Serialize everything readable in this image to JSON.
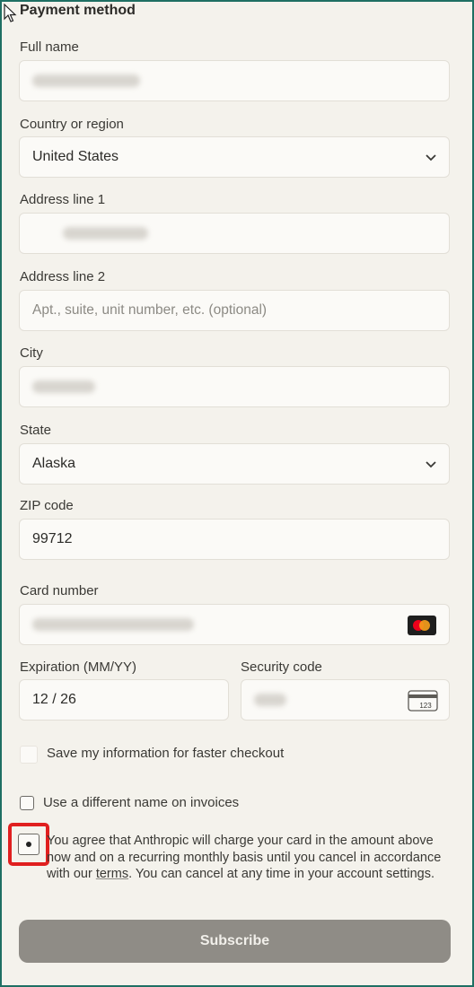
{
  "section_title": "Payment method",
  "fields": {
    "full_name_label": "Full name",
    "country_label": "Country or region",
    "country_value": "United States",
    "address1_label": "Address line 1",
    "address2_label": "Address line 2",
    "address2_placeholder": "Apt., suite, unit number, etc. (optional)",
    "city_label": "City",
    "state_label": "State",
    "state_value": "Alaska",
    "zip_label": "ZIP code",
    "zip_value": "99712",
    "card_number_label": "Card number",
    "expiration_label": "Expiration (MM/YY)",
    "expiration_value": "12 / 26",
    "security_label": "Security code",
    "security_icon_text": "123"
  },
  "checkboxes": {
    "save_info": "Save my information for faster checkout",
    "different_name": "Use a different name on invoices",
    "agree_pre": "You agree that Anthropic will charge your card in the amount above now and on a recurring monthly basis until you cancel in accordance with our ",
    "agree_link": "terms",
    "agree_post": ". You can cancel at any time in your account settings."
  },
  "subscribe_label": "Subscribe",
  "colors": {
    "highlight": "#e01f1f",
    "button": "#8f8c86",
    "frame": "#1f6f63"
  },
  "icons": {
    "card_brand": "mastercard-icon",
    "security": "card-back-cvc-icon",
    "select": "chevron-down-icon"
  }
}
